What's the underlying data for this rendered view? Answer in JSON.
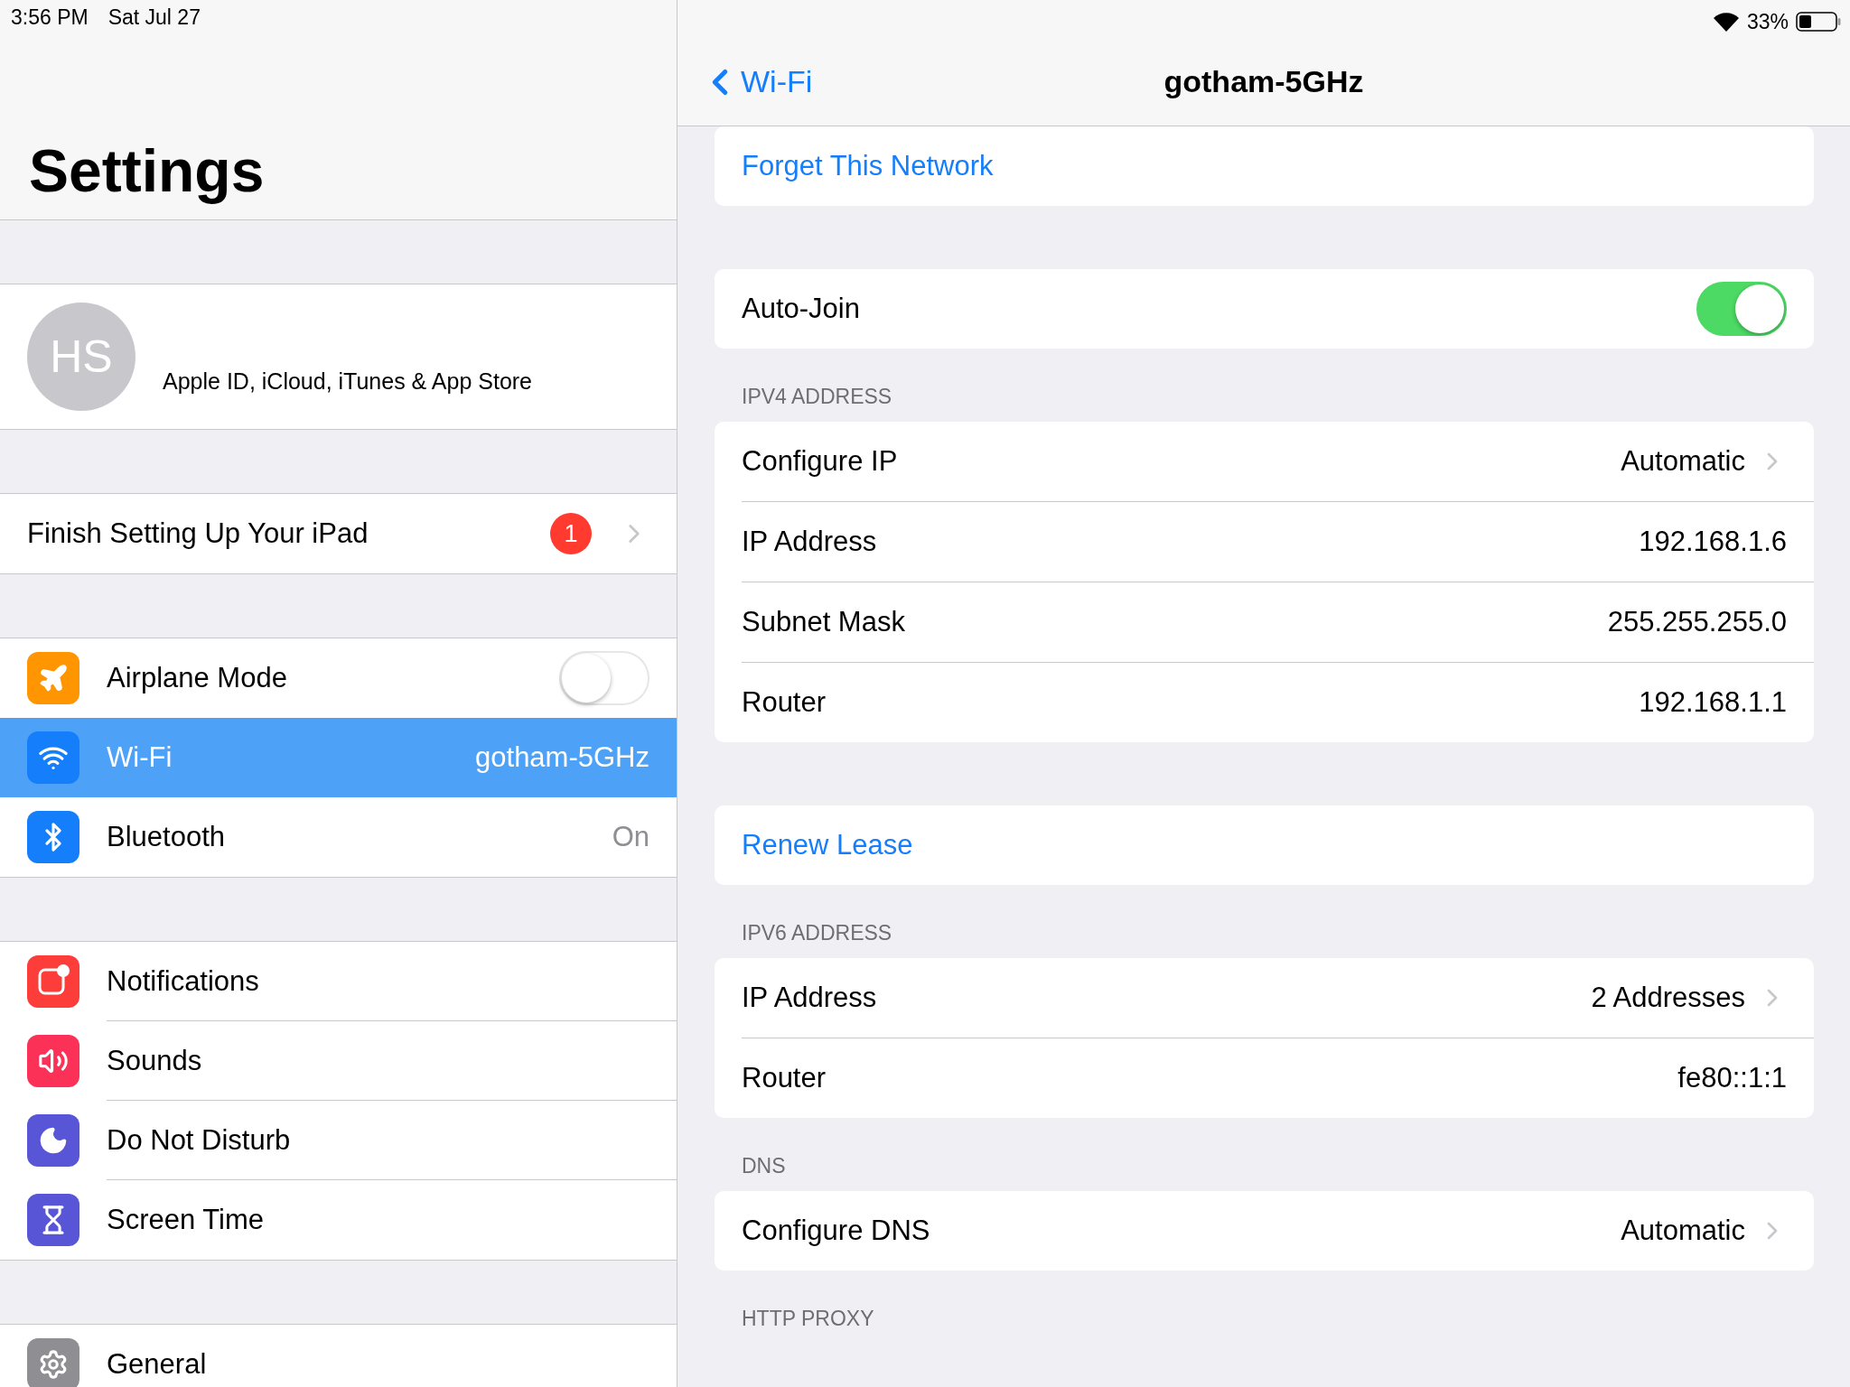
{
  "status_bar": {
    "time": "3:56 PM",
    "date": "Sat Jul 27",
    "battery": "33%"
  },
  "sidebar": {
    "title": "Settings",
    "profile": {
      "initials": "HS",
      "subtitle": "Apple ID, iCloud, iTunes & App Store"
    },
    "groups": [
      [
        {
          "kind": "link",
          "label": "Finish Setting Up Your iPad",
          "badge": "1",
          "selected": false
        }
      ],
      [
        {
          "kind": "toggle",
          "label": "Airplane Mode",
          "on": false,
          "color": "#ff9500",
          "selected": false
        },
        {
          "kind": "value",
          "label": "Wi-Fi",
          "value": "gotham-5GHz",
          "color": "#147efb",
          "selected": true
        },
        {
          "kind": "value",
          "label": "Bluetooth",
          "value": "On",
          "color": "#147efb",
          "selected": false
        }
      ],
      [
        {
          "kind": "plain",
          "label": "Notifications",
          "color": "#fc3d39",
          "selected": false
        },
        {
          "kind": "plain",
          "label": "Sounds",
          "color": "#fc3158",
          "selected": false
        },
        {
          "kind": "plain",
          "label": "Do Not Disturb",
          "color": "#5856d6",
          "selected": false
        },
        {
          "kind": "plain",
          "label": "Screen Time",
          "color": "#5856d6",
          "selected": false
        }
      ],
      [
        {
          "kind": "plain",
          "label": "General",
          "color": "#8e8e93",
          "selected": false
        }
      ]
    ]
  },
  "detail": {
    "back": "Wi-Fi",
    "title": "gotham-5GHz",
    "sections": [
      {
        "rows": [
          {
            "kind": "action",
            "label": "Forget This Network"
          }
        ]
      },
      {
        "rows": [
          {
            "kind": "toggle",
            "label": "Auto-Join",
            "on": true
          }
        ]
      },
      {
        "header": "IPV4 ADDRESS",
        "rows": [
          {
            "kind": "link",
            "label": "Configure IP",
            "value": "Automatic"
          },
          {
            "kind": "value",
            "label": "IP Address",
            "value": "192.168.1.6"
          },
          {
            "kind": "value",
            "label": "Subnet Mask",
            "value": "255.255.255.0"
          },
          {
            "kind": "value",
            "label": "Router",
            "value": "192.168.1.1"
          }
        ]
      },
      {
        "rows": [
          {
            "kind": "action",
            "label": "Renew Lease"
          }
        ]
      },
      {
        "header": "IPV6 ADDRESS",
        "rows": [
          {
            "kind": "link",
            "label": "IP Address",
            "value": "2 Addresses"
          },
          {
            "kind": "value",
            "label": "Router",
            "value": "fe80::1:1"
          }
        ]
      },
      {
        "header": "DNS",
        "rows": [
          {
            "kind": "link",
            "label": "Configure DNS",
            "value": "Automatic"
          }
        ]
      },
      {
        "header": "HTTP PROXY"
      }
    ]
  }
}
